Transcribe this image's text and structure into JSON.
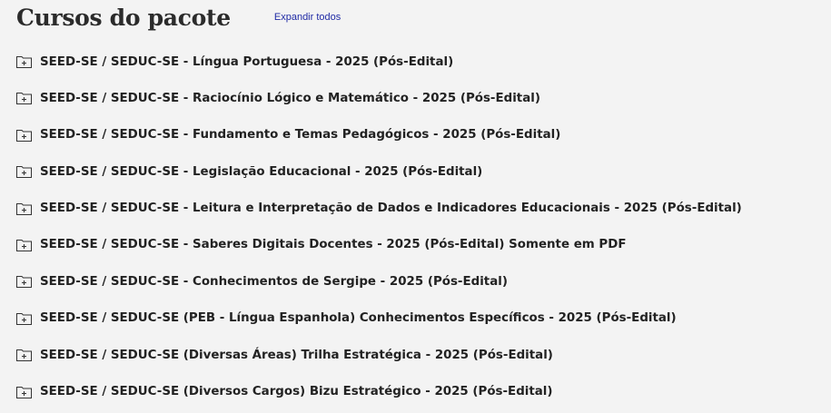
{
  "header": {
    "title": "Cursos do pacote",
    "expand_label": "Expandir todos"
  },
  "courses": [
    {
      "label": "SEED-SE / SEDUC-SE - Língua Portuguesa - 2025 (Pós-Edital)",
      "icon": "folder-plus-icon"
    },
    {
      "label": "SEED-SE / SEDUC-SE - Raciocínio Lógico e Matemático - 2025 (Pós-Edital)",
      "icon": "folder-plus-icon"
    },
    {
      "label": "SEED-SE / SEDUC-SE - Fundamento e Temas Pedagógicos - 2025 (Pós-Edital)",
      "icon": "folder-plus-icon"
    },
    {
      "label": "SEED-SE / SEDUC-SE - Legislação Educacional - 2025 (Pós-Edital)",
      "icon": "folder-plus-icon"
    },
    {
      "label": "SEED-SE / SEDUC-SE - Leitura e Interpretação de Dados e Indicadores Educacionais - 2025 (Pós-Edital)",
      "icon": "folder-plus-icon"
    },
    {
      "label": "SEED-SE / SEDUC-SE - Saberes Digitais Docentes - 2025 (Pós-Edital) Somente em PDF",
      "icon": "folder-plus-icon"
    },
    {
      "label": "SEED-SE / SEDUC-SE - Conhecimentos de Sergipe - 2025 (Pós-Edital)",
      "icon": "folder-plus-icon"
    },
    {
      "label": "SEED-SE / SEDUC-SE (PEB - Língua Espanhola) Conhecimentos Específicos - 2025 (Pós-Edital)",
      "icon": "folder-plus-icon"
    },
    {
      "label": "SEED-SE / SEDUC-SE (Diversas Áreas) Trilha Estratégica - 2025 (Pós-Edital)",
      "icon": "folder-plus-icon"
    },
    {
      "label": "SEED-SE / SEDUC-SE (Diversos Cargos) Bizu Estratégico - 2025 (Pós-Edital)",
      "icon": "folder-plus-icon"
    }
  ],
  "colors": {
    "background": "#f3f3f3",
    "title": "#2b2b2b",
    "link": "#1f2aa5",
    "text": "#222222",
    "icon_stroke": "#333333"
  }
}
